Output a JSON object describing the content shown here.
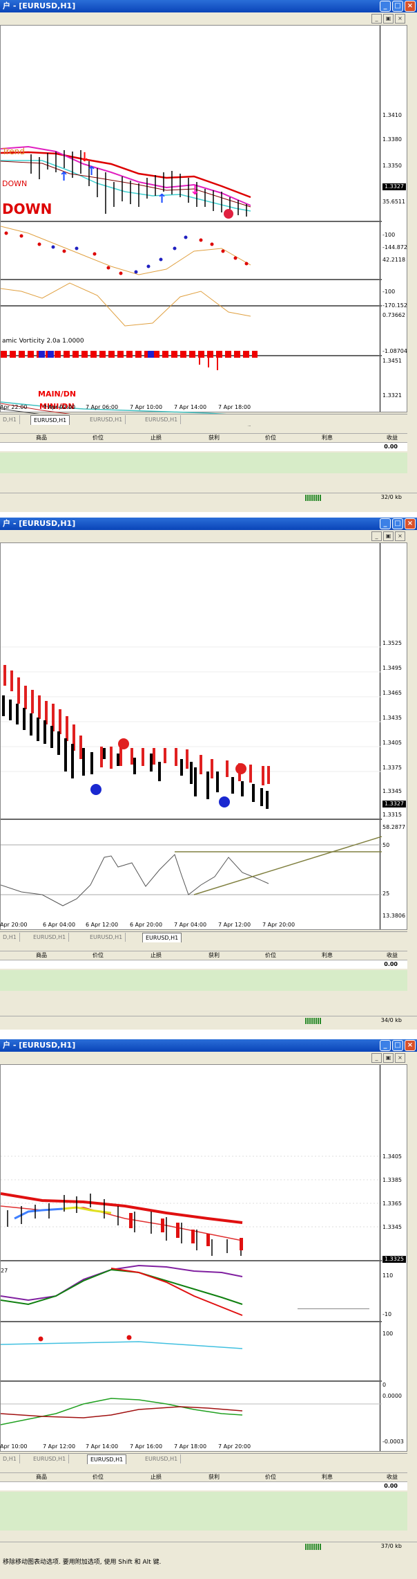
{
  "windows": [
    {
      "title": "户 - [EURUSD,H1]",
      "prices": [
        "1.3410",
        "1.3380",
        "1.3350",
        "1.3327"
      ],
      "current_price": "1.3327",
      "labels": {
        "trend": "Trend",
        "down1": "DOWN",
        "down2": "DOWN",
        "vorticity": "amic Vorticity 2.0a 1.0000",
        "main": "MAIN/DN",
        "mini": "MINI/DN"
      },
      "sub_scales": [
        [
          "35.6511",
          "-100",
          "-144.872"
        ],
        [
          "42.2118",
          "-100",
          "-170.152"
        ],
        [
          "0.73662",
          "-1.08704"
        ],
        [
          "1.3451",
          "1.3321"
        ]
      ],
      "time_labels": [
        "Apr 22:00",
        "7 Apr 02:00",
        "7 Apr 06:00",
        "7 Apr 10:00",
        "7 Apr 14:00",
        "7 Apr 18:00"
      ],
      "tabs": [
        "D,H1",
        "EURUSD,H1",
        "EURUSD,H1",
        "EURUSD,H1"
      ],
      "active_tab": 1,
      "status": "32/0 kb"
    },
    {
      "title": "户 - [EURUSD,H1]",
      "prices": [
        "1.3525",
        "1.3495",
        "1.3465",
        "1.3435",
        "1.3405",
        "1.3375",
        "1.3345",
        "1.3327",
        "1.3315"
      ],
      "current_price": "1.3327",
      "sub_scales": [
        "58.2877",
        "50",
        "25",
        "13.3806"
      ],
      "time_labels": [
        "Apr 20:00",
        "6 Apr 04:00",
        "6 Apr 12:00",
        "6 Apr 20:00",
        "7 Apr 04:00",
        "7 Apr 12:00",
        "7 Apr 20:00"
      ],
      "tabs": [
        "D,H1",
        "EURUSD,H1",
        "EURUSD,H1",
        "EURUSD,H1"
      ],
      "active_tab": 3,
      "status": "34/0 kb"
    },
    {
      "title": "户 - [EURUSD,H1]",
      "prices": [
        "1.3405",
        "1.3385",
        "1.3365",
        "1.3345",
        "1.3325"
      ],
      "current_price": "1.3325",
      "sub_scales": [
        [
          "27",
          "110",
          "-10"
        ],
        [
          "100",
          "0"
        ],
        [
          "0.0000",
          "-0.0003"
        ]
      ],
      "time_labels": [
        "Apr 10:00",
        "7 Apr 12:00",
        "7 Apr 14:00",
        "7 Apr 16:00",
        "7 Apr 18:00",
        "7 Apr 20:00"
      ],
      "tabs": [
        "D,H1",
        "EURUSD,H1",
        "EURUSD,H1",
        "EURUSD,H1"
      ],
      "active_tab": 2,
      "status": "37/0 kb"
    }
  ],
  "terminal": {
    "columns": [
      "商品",
      "价位",
      "止损",
      "获利",
      "价位",
      "利息",
      "收益"
    ],
    "balance": "0.00"
  },
  "bottom_text": "移除移动图表动选项. 要用附加选项, 使用 Shift 和 Alt 键."
}
